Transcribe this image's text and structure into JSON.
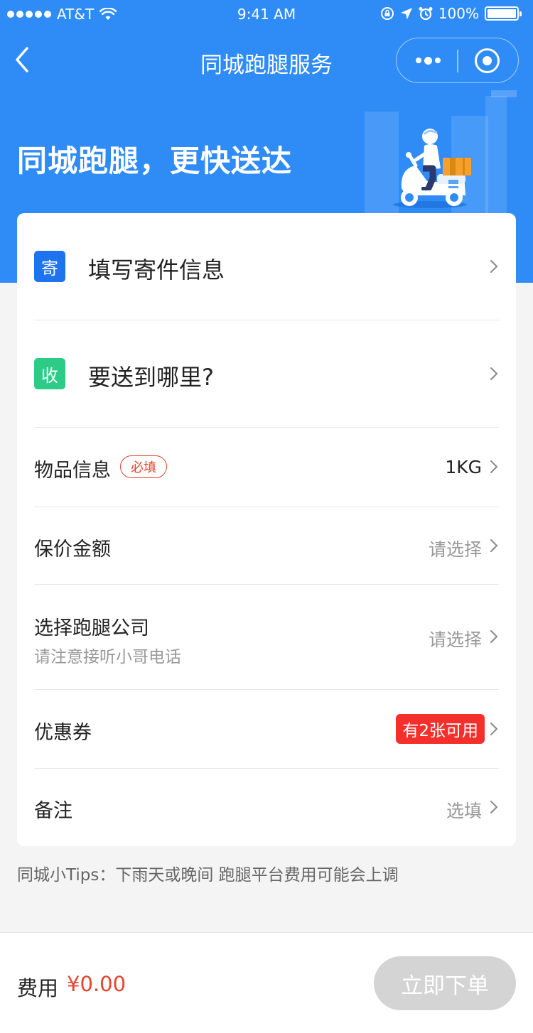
{
  "status_bar": {
    "carrier": "AT&T",
    "time": "9:41 AM",
    "battery": "100%",
    "battery_level": 1.0
  },
  "nav": {
    "title": "同城跑腿服务",
    "back_icon": "chevron-left-icon",
    "more_icon": "more-dots-icon",
    "close_icon": "target-icon"
  },
  "hero": {
    "slogan": "同城跑腿，更快送达",
    "illustration": "delivery-scooter-illustration"
  },
  "colors": {
    "primary": "#2f8cf7",
    "send_badge": "#1e74ee",
    "receive_badge": "#2ccc87",
    "accent_red": "#e6442d",
    "coupon_red": "#f5302c"
  },
  "form": {
    "sender": {
      "badge": "寄",
      "label": "填写寄件信息"
    },
    "receiver": {
      "badge": "收",
      "label": "要送到哪里?"
    },
    "items": {
      "label": "物品信息",
      "required_tag": "必填",
      "value": "1KG"
    },
    "insurance": {
      "label": "保价金额",
      "value": "请选择"
    },
    "company": {
      "label": "选择跑腿公司",
      "sublabel": "请注意接听小哥电话",
      "value": "请选择"
    },
    "coupon": {
      "label": "优惠券",
      "badge": "有2张可用"
    },
    "remark": {
      "label": "备注",
      "value": "选填"
    }
  },
  "tips": "同城小Tips：下雨天或晚间 跑腿平台费用可能会上调",
  "footer": {
    "fee_label": "费用",
    "fee_amount": "¥0.00",
    "order_button": "立即下单"
  }
}
